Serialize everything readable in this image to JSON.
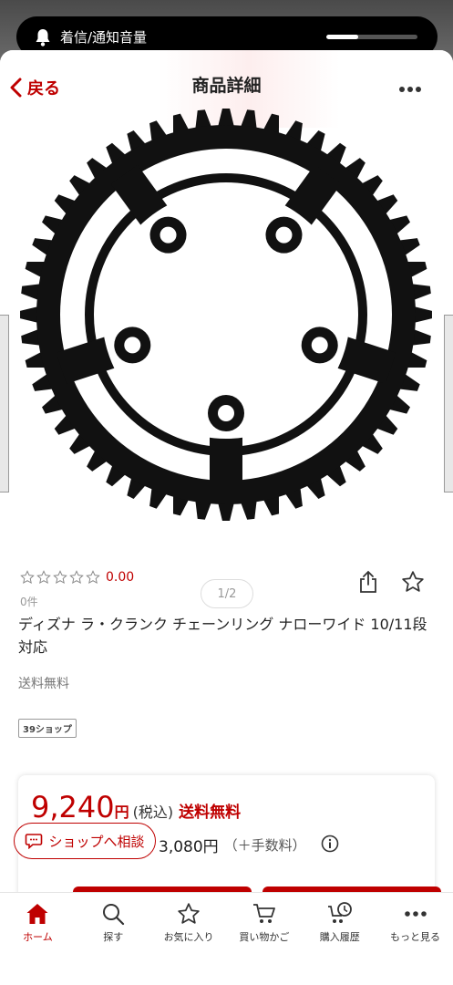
{
  "notification": {
    "label": "着信/通知音量",
    "volume_level": 0.35
  },
  "navbar": {
    "back_label": "戻る",
    "title": "商品詳細"
  },
  "carousel": {
    "pager": "1/2"
  },
  "product": {
    "rating": "0.00",
    "review_count": "0件",
    "name": "ディズナ ラ・クランク チェーンリング ナローワイド 10/11段対応",
    "shipping": "送料無料",
    "shop_badge": "39ショップ"
  },
  "price": {
    "amount": "9,240",
    "yen": "円",
    "tax": "(税込)",
    "free_shipping": "送料無料",
    "points": "3,080円",
    "fee_note": "（＋手数料）"
  },
  "consult_button": "ショップへ相談",
  "tabs": [
    {
      "label": "ホーム",
      "icon": "home-icon",
      "active": true
    },
    {
      "label": "探す",
      "icon": "search-icon",
      "active": false
    },
    {
      "label": "お気に入り",
      "icon": "star-icon",
      "active": false
    },
    {
      "label": "買い物かご",
      "icon": "cart-icon",
      "active": false
    },
    {
      "label": "購入履歴",
      "icon": "history-icon",
      "active": false
    },
    {
      "label": "もっと見る",
      "icon": "more-icon",
      "active": false
    }
  ],
  "colors": {
    "accent": "#bf0000"
  }
}
